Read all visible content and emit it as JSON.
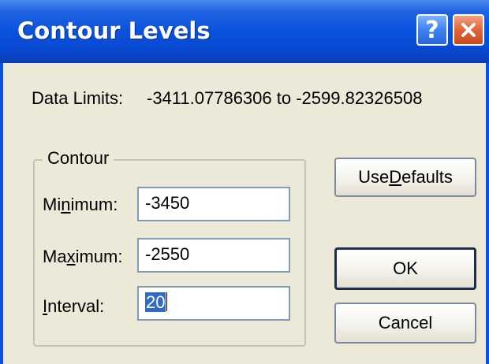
{
  "window": {
    "title": "Contour Levels"
  },
  "titlebar_buttons": {
    "help": "?"
  },
  "data_limits": {
    "label": "Data Limits:",
    "value": "-3411.07786306 to -2599.82326508"
  },
  "contour": {
    "group_label": "Contour",
    "minimum": {
      "label_pre": "Mi",
      "label_accel": "n",
      "label_post": "imum:",
      "value": "-3450"
    },
    "maximum": {
      "label_pre": "Ma",
      "label_accel": "x",
      "label_post": "imum:",
      "value": "-2550"
    },
    "interval": {
      "label_pre": "",
      "label_accel": "I",
      "label_post": "nterval:",
      "value": "20"
    }
  },
  "buttons": {
    "use_defaults": {
      "pre": "Use ",
      "accel": "D",
      "post": "efaults"
    },
    "ok": "OK",
    "cancel": "Cancel"
  },
  "colors": {
    "titlebar": "#0a52de",
    "dialog_bg": "#ece9d8",
    "selection": "#316ac5"
  }
}
